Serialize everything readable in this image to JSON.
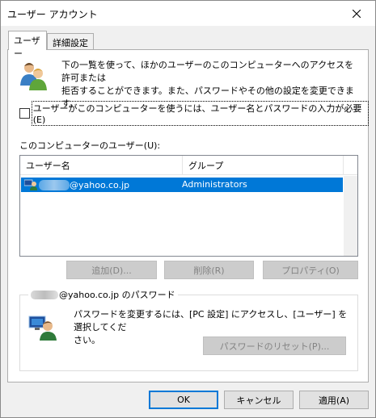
{
  "window": {
    "title": "ユーザー アカウント"
  },
  "tabs": [
    {
      "label": "ユーザー",
      "active": true
    },
    {
      "label": "詳細設定",
      "active": false
    }
  ],
  "intro": {
    "line1": "下の一覧を使って、ほかのユーザーのこのコンピューターへのアクセスを許可または",
    "line2": "拒否することができます。また、パスワードやその他の設定を変更できます。"
  },
  "require_password": {
    "label": "ユーザーがこのコンピューターを使うには、ユーザー名とパスワードの入力が必要(E)",
    "checked": false
  },
  "users_label": "このコンピューターのユーザー(U):",
  "users_table": {
    "columns": [
      "ユーザー名",
      "グループ"
    ],
    "rows": [
      {
        "user": "@yahoo.co.jp",
        "group": "Administrators",
        "selected": true
      }
    ]
  },
  "user_buttons": {
    "add": "追加(D)...",
    "delete": "削除(R)",
    "properties": "プロパティ(O)"
  },
  "password_group": {
    "legend": "@yahoo.co.jp のパスワード",
    "line1": "パスワードを変更するには、[PC 設定] にアクセスし、[ユーザー] を選択してくだ",
    "line2": "さい。",
    "reset_button": "パスワードのリセット(P)..."
  },
  "footer": {
    "ok": "OK",
    "cancel": "キャンセル",
    "apply": "適用(A)"
  },
  "colors": {
    "accent": "#0078d7",
    "selection": "#0078d7",
    "dialog_bg": "#f0f0f0"
  }
}
